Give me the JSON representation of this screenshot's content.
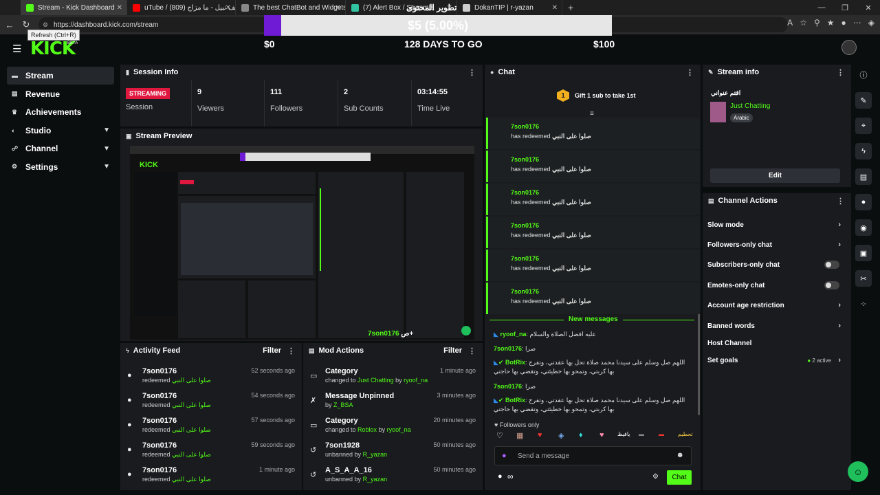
{
  "browser": {
    "tabs": [
      {
        "label": "Stream - Kick Dashboard",
        "color": "#53fc18",
        "active": true
      },
      {
        "label": "uTube / سيف نبيل - ما مزاج (809)",
        "color": "#ff0000"
      },
      {
        "label": "The best ChatBot and Widgets fo",
        "color": "#888888"
      },
      {
        "label": "(7) Alert Box / Streamla",
        "color": "#31c3a2"
      },
      {
        "label": "DokanTIP | r-yazan",
        "color": "#cccccc"
      }
    ],
    "tab_overlay_text": "تطوير المحتوى",
    "new_tab": "+",
    "url": "https://dashboard.kick.com/stream",
    "tooltip": "Refresh (Ctrl+R)"
  },
  "goal": {
    "amount_text": "$5 (5.00%)",
    "progress": 0.05,
    "start": "$0",
    "days_left": "128 DAYS TO GO",
    "target": "$100"
  },
  "app": {
    "logo": "KICK",
    "beta": "BETA"
  },
  "sidebar": [
    {
      "label": "Stream",
      "icon": "stream-icon",
      "active": true
    },
    {
      "label": "Revenue",
      "icon": "revenue-icon"
    },
    {
      "label": "Achievements",
      "icon": "trophy-icon"
    },
    {
      "label": "Studio",
      "icon": "studio-icon",
      "expand": true
    },
    {
      "label": "Channel",
      "icon": "channel-icon",
      "expand": true
    },
    {
      "label": "Settings",
      "icon": "gear-icon",
      "expand": true
    }
  ],
  "session": {
    "title": "Session Info",
    "status": "STREAMING",
    "status_label": "Session",
    "stats": [
      {
        "value": "9",
        "label": "Viewers"
      },
      {
        "value": "111",
        "label": "Followers"
      },
      {
        "value": "2",
        "label": "Sub Counts"
      },
      {
        "value": "03:14:55",
        "label": "Time Live"
      }
    ]
  },
  "preview": {
    "title": "Stream Preview",
    "overlay_user": "7son0176",
    "overlay_text": "ص+"
  },
  "activity": {
    "title": "Activity Feed",
    "filter": "Filter",
    "items": [
      {
        "name": "7son0176",
        "action": "redeemed",
        "reward": "صلوا على النبي",
        "time": "52 seconds ago"
      },
      {
        "name": "7son0176",
        "action": "redeemed",
        "reward": "صلوا على النبي",
        "time": "54 seconds ago"
      },
      {
        "name": "7son0176",
        "action": "redeemed",
        "reward": "صلوا على النبي",
        "time": "57 seconds ago"
      },
      {
        "name": "7son0176",
        "action": "redeemed",
        "reward": "صلوا على النبي",
        "time": "59 seconds ago"
      },
      {
        "name": "7son0176",
        "action": "redeemed",
        "reward": "صلوا على النبي",
        "time": "1 minute ago"
      }
    ]
  },
  "mod": {
    "title": "Mod Actions",
    "filter": "Filter",
    "items": [
      {
        "icon": "category-icon",
        "title": "Category",
        "pre": "changed to ",
        "target": "Just Chatting",
        "mid": " by ",
        "user": "ryoof_na",
        "time": "1 minute ago"
      },
      {
        "icon": "unpin-icon",
        "title": "Message Unpinned",
        "pre": "by ",
        "target": "",
        "mid": "",
        "user": "Z_BSA",
        "time": "3 minutes ago"
      },
      {
        "icon": "category-icon",
        "title": "Category",
        "pre": "changed to ",
        "target": "Roblox",
        "mid": " by ",
        "user": "ryoof_na",
        "time": "20 minutes ago"
      },
      {
        "icon": "unban-icon",
        "title": "7son1928",
        "pre": "unbanned by ",
        "target": "",
        "mid": "",
        "user": "R_yazan",
        "time": "50 minutes ago"
      },
      {
        "icon": "unban-icon",
        "title": "A_S_A_A_16",
        "pre": "unbanned by ",
        "target": "",
        "mid": "",
        "user": "R_yazan",
        "time": "50 minutes ago"
      }
    ]
  },
  "chat": {
    "title": "Chat",
    "gift_badge": "1",
    "gift_text": "Gift 1 sub to take 1st",
    "redeems": [
      {
        "name": "7son0176",
        "text": "has redeemed",
        "reward": "صلوا على النبي"
      },
      {
        "name": "7son0176",
        "text": "has redeemed",
        "reward": "صلوا على النبي"
      },
      {
        "name": "7son0176",
        "text": "has redeemed",
        "reward": "صلوا على النبي"
      },
      {
        "name": "7son0176",
        "text": "has redeemed",
        "reward": "صلوا على النبي"
      },
      {
        "name": "7son0176",
        "text": "has redeemed",
        "reward": "صلوا على النبي"
      },
      {
        "name": "7son0176",
        "text": "has redeemed",
        "reward": "صلوا على النبي"
      }
    ],
    "new_messages": "New messages",
    "messages": [
      {
        "user": "ryoof_na",
        "color": "#53fc18",
        "text": "عليه افضل الصلاة والسلام"
      },
      {
        "user": "7son0176",
        "color": "#53fc18",
        "text": "صرا"
      },
      {
        "user": "BotRix",
        "color": "#53fc18",
        "text": "اللهم صل وسلم على سيدنا محمد صلاة تحل بها عقدتي، وتفرج بها كربتي، وتمحو بها خطيئتي، وتقضي بها حاجتي"
      },
      {
        "user": "7son0176",
        "color": "#53fc18",
        "text": "صرا"
      },
      {
        "user": "BotRix",
        "color": "#53fc18",
        "text": "اللهم صل وسلم على سيدنا محمد صلاة تحل بها عقدتي، وتفرج بها كربتي، وتمحو بها خطيئتي، وتقضي بها حاجتي"
      }
    ],
    "followers_only": "Followers only",
    "emotes": [
      "♡",
      "▦",
      "♥",
      "◈",
      "♦",
      "♥",
      "يافيظ",
      "▬",
      "▬",
      "تحطيم"
    ],
    "input_placeholder": "Send a message",
    "send": "Chat"
  },
  "stream_info": {
    "title": "Stream info",
    "stream_title": "اقتم عنواني",
    "category": "Just Chatting",
    "language": "Arabic",
    "edit": "Edit"
  },
  "channel_actions": {
    "title": "Channel Actions",
    "items": [
      {
        "label": "Slow mode",
        "kind": "arrow"
      },
      {
        "label": "Followers-only chat",
        "kind": "arrow"
      },
      {
        "label": "Subscribers-only chat",
        "kind": "toggle"
      },
      {
        "label": "Emotes-only chat",
        "kind": "toggle"
      },
      {
        "label": "Account age restriction",
        "kind": "arrow"
      },
      {
        "label": "Banned words",
        "kind": "arrow"
      },
      {
        "label": "Host Channel",
        "kind": "none"
      },
      {
        "label": "Set goals",
        "kind": "arrow",
        "extra": "2 active"
      }
    ]
  },
  "rail": [
    "info-icon",
    "pencil-icon",
    "target-icon",
    "bolt-icon",
    "doc-icon",
    "chat-icon",
    "broadcast-icon",
    "layout-icon",
    "wrench-icon",
    "dots-icon"
  ],
  "colors": {
    "accent": "#53fc18",
    "streaming": "#e0173f",
    "goal": "#6f1bd6"
  }
}
